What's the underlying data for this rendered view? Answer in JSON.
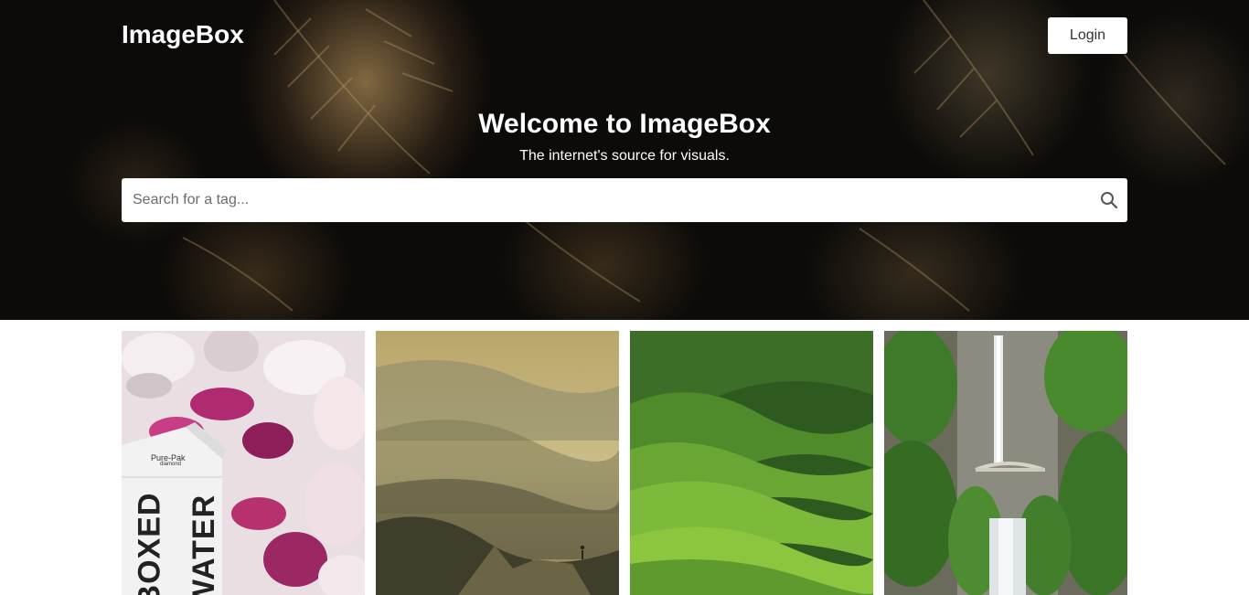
{
  "header": {
    "brand": "ImageBox",
    "login_label": "Login"
  },
  "hero": {
    "title": "Welcome to ImageBox",
    "subtitle": "The internet's source for visuals.",
    "search": {
      "placeholder": "Search for a tag...",
      "value": "",
      "icon": "search-icon"
    }
  },
  "gallery": {
    "images": [
      {
        "subject": "flowers-boxed-water",
        "carton_brand": "Pure-Pak",
        "carton_sub": "diamond",
        "carton_text_1": "BOXED",
        "carton_text_2": "WATER"
      },
      {
        "subject": "misty-mountains"
      },
      {
        "subject": "green-hills"
      },
      {
        "subject": "waterfall-bridge"
      }
    ]
  },
  "colors": {
    "hero_bg": "#0d0b09",
    "text_light": "#ffffff",
    "button_bg": "#ffffff"
  }
}
